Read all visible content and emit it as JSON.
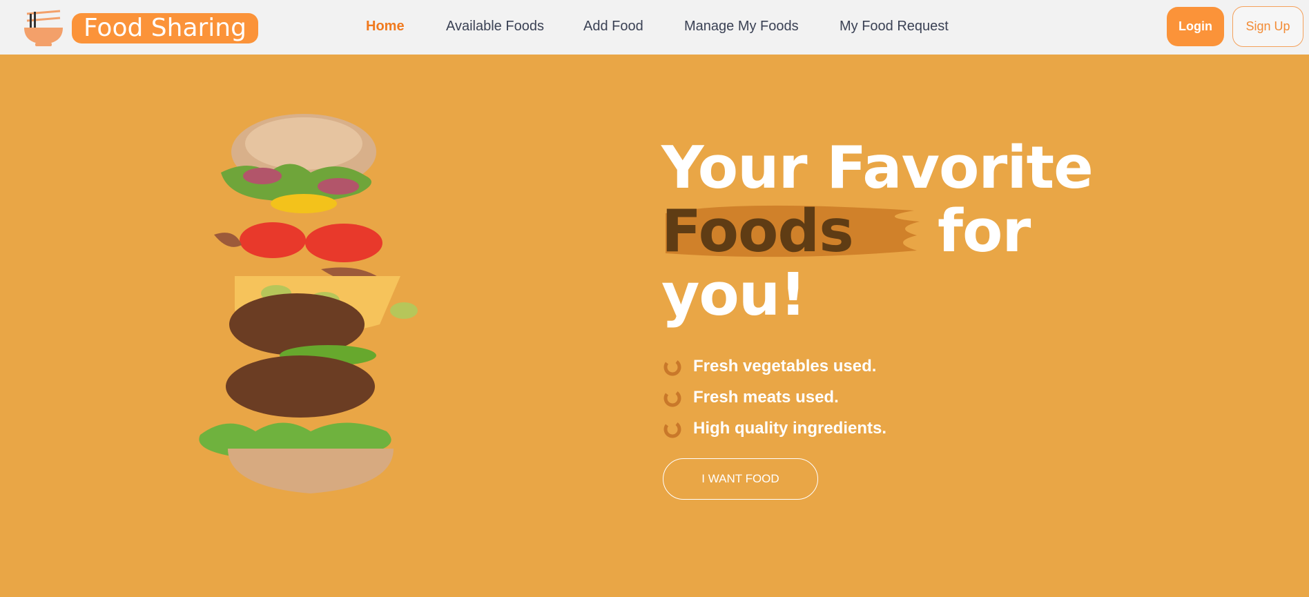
{
  "nav": {
    "brand": "Food Sharing",
    "links": [
      {
        "label": "Home",
        "active": true
      },
      {
        "label": "Available Foods"
      },
      {
        "label": "Add Food"
      },
      {
        "label": "Manage My Foods"
      },
      {
        "label": "My Food Request"
      }
    ],
    "login": "Login",
    "signup": "Sign Up"
  },
  "hero": {
    "line1": "Your Favorite",
    "highlight": "Foods",
    "line2_rest": "for",
    "line3": "you!",
    "features": [
      "Fresh vegetables used.",
      "Fresh meats used.",
      "High quality ingredients."
    ],
    "cta": "I WANT FOOD"
  },
  "colors": {
    "accent": "#fb9339",
    "hero_bg": "#e9a646",
    "highlight_text": "#5f3c14",
    "brush": "#d0812a"
  },
  "icons": [
    "noodle-bowl-logo-icon",
    "spiral-bullet-icon"
  ]
}
